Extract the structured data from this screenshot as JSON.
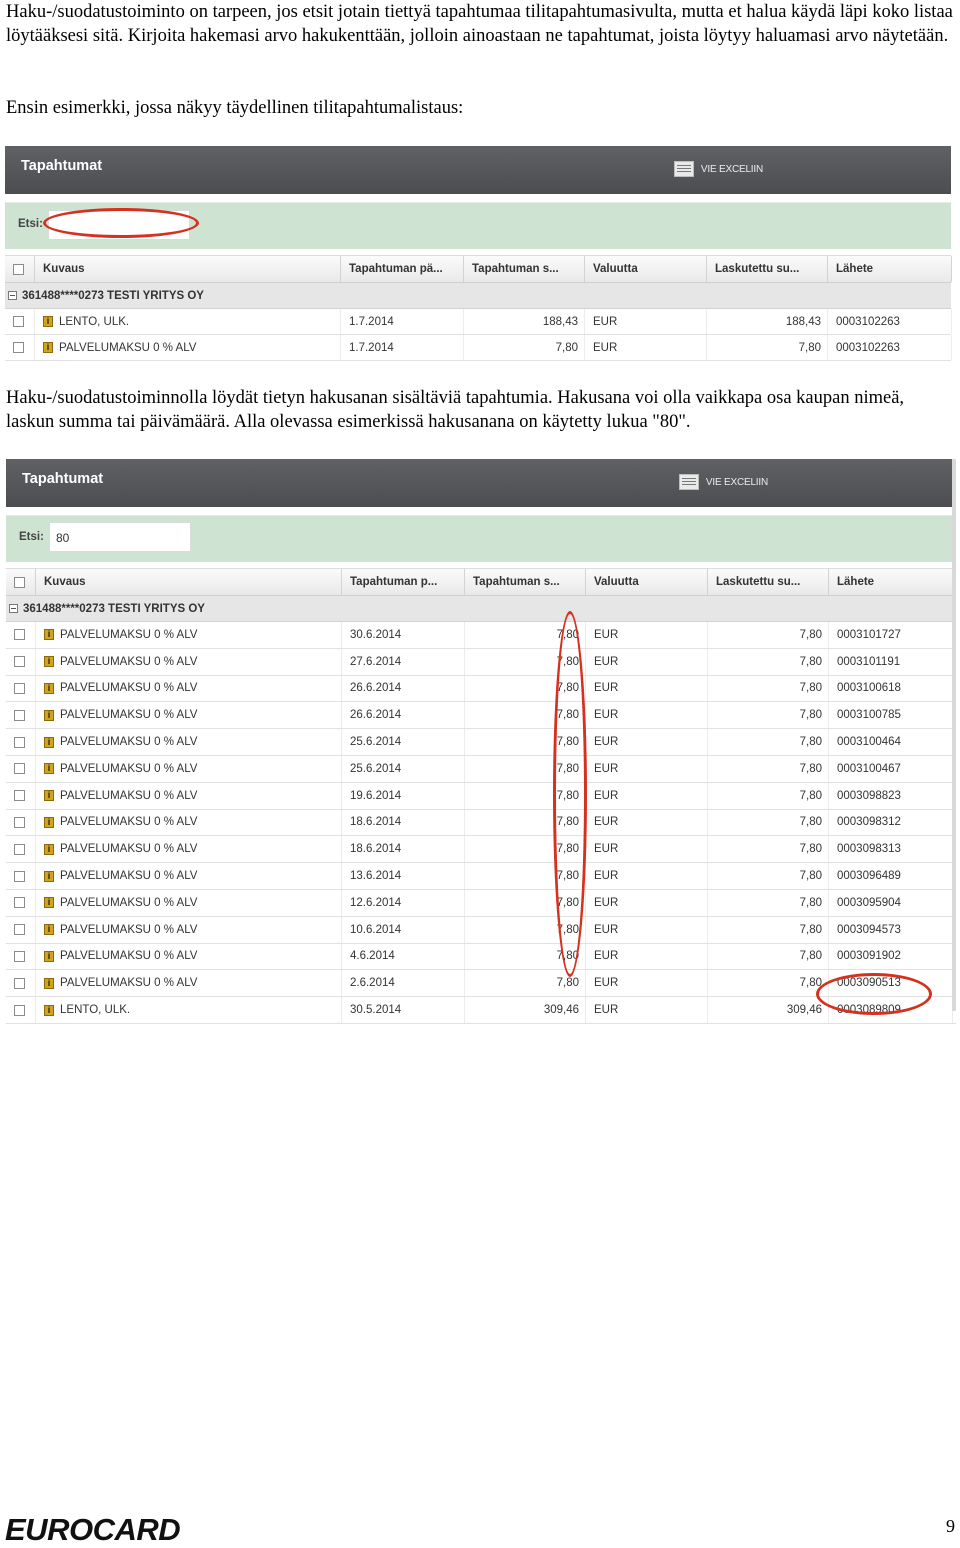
{
  "intro": {
    "p1": "Haku-/suodatustoiminto on tarpeen, jos etsit jotain tiettyä tapahtumaa tilitapahtumasivulta, mutta et halua käydä läpi koko listaa löytääksesi sitä. Kirjoita hakemasi arvo hakukenttään, jolloin ainoastaan ne tapahtumat, joista löytyy haluamasi arvo näytetään.",
    "p2": "Ensin esimerkki, jossa näkyy täydellinen tilitapahtumalistaus:"
  },
  "middle": {
    "p3": "Haku-/suodatustoiminnolla löydät tietyn hakusanan sisältäviä tapahtumia. Hakusana voi olla vaikkapa osa kaupan nimeä, laskun summa tai päivämäärä. Alla olevassa esimerkissä hakusanana on käytetty lukua \"80\"."
  },
  "panel": {
    "title": "Tapahtumat",
    "export_label": "VIE EXCELIIN",
    "search_label": "Etsi:",
    "columns": [
      "Kuvaus",
      "Tapahtuman pä...",
      "Tapahtuman s...",
      "Valuutta",
      "Laskutettu su...",
      "Lähete"
    ],
    "columns2": [
      "Kuvaus",
      "Tapahtuman p...",
      "Tapahtuman s...",
      "Valuutta",
      "Laskutettu su...",
      "Lähete"
    ],
    "group": "361488****0273 TESTI YRITYS OY"
  },
  "screenshot1": {
    "search_value": "",
    "rows": [
      [
        "LENTO, ULK.",
        "1.7.2014",
        "188,43",
        "EUR",
        "188,43",
        "0003102263"
      ],
      [
        "PALVELUMAKSU 0 % ALV",
        "1.7.2014",
        "7,80",
        "EUR",
        "7,80",
        "0003102263"
      ]
    ]
  },
  "screenshot2": {
    "search_value": "80",
    "rows": [
      [
        "PALVELUMAKSU 0 % ALV",
        "30.6.2014",
        "7,80",
        "EUR",
        "7,80",
        "0003101727"
      ],
      [
        "PALVELUMAKSU 0 % ALV",
        "27.6.2014",
        "7,80",
        "EUR",
        "7,80",
        "0003101191"
      ],
      [
        "PALVELUMAKSU 0 % ALV",
        "26.6.2014",
        "7,80",
        "EUR",
        "7,80",
        "0003100618"
      ],
      [
        "PALVELUMAKSU 0 % ALV",
        "26.6.2014",
        "7,80",
        "EUR",
        "7,80",
        "0003100785"
      ],
      [
        "PALVELUMAKSU 0 % ALV",
        "25.6.2014",
        "7,80",
        "EUR",
        "7,80",
        "0003100464"
      ],
      [
        "PALVELUMAKSU 0 % ALV",
        "25.6.2014",
        "7,80",
        "EUR",
        "7,80",
        "0003100467"
      ],
      [
        "PALVELUMAKSU 0 % ALV",
        "19.6.2014",
        "7,80",
        "EUR",
        "7,80",
        "0003098823"
      ],
      [
        "PALVELUMAKSU 0 % ALV",
        "18.6.2014",
        "7,80",
        "EUR",
        "7,80",
        "0003098312"
      ],
      [
        "PALVELUMAKSU 0 % ALV",
        "18.6.2014",
        "7,80",
        "EUR",
        "7,80",
        "0003098313"
      ],
      [
        "PALVELUMAKSU 0 % ALV",
        "13.6.2014",
        "7,80",
        "EUR",
        "7,80",
        "0003096489"
      ],
      [
        "PALVELUMAKSU 0 % ALV",
        "12.6.2014",
        "7,80",
        "EUR",
        "7,80",
        "0003095904"
      ],
      [
        "PALVELUMAKSU 0 % ALV",
        "10.6.2014",
        "7,80",
        "EUR",
        "7,80",
        "0003094573"
      ],
      [
        "PALVELUMAKSU 0 % ALV",
        "4.6.2014",
        "7,80",
        "EUR",
        "7,80",
        "0003091902"
      ],
      [
        "PALVELUMAKSU 0 % ALV",
        "2.6.2014",
        "7,80",
        "EUR",
        "7,80",
        "0003090513"
      ],
      [
        "LENTO, ULK.",
        "30.5.2014",
        "309,46",
        "EUR",
        "309,46",
        "0003089809"
      ]
    ]
  },
  "footer": {
    "logo": "EUROCARD",
    "page_number": "9"
  },
  "colors": {
    "title_bar": "#55575b",
    "search_bar": "#cfe3d2",
    "annotation": "#d6301f"
  }
}
